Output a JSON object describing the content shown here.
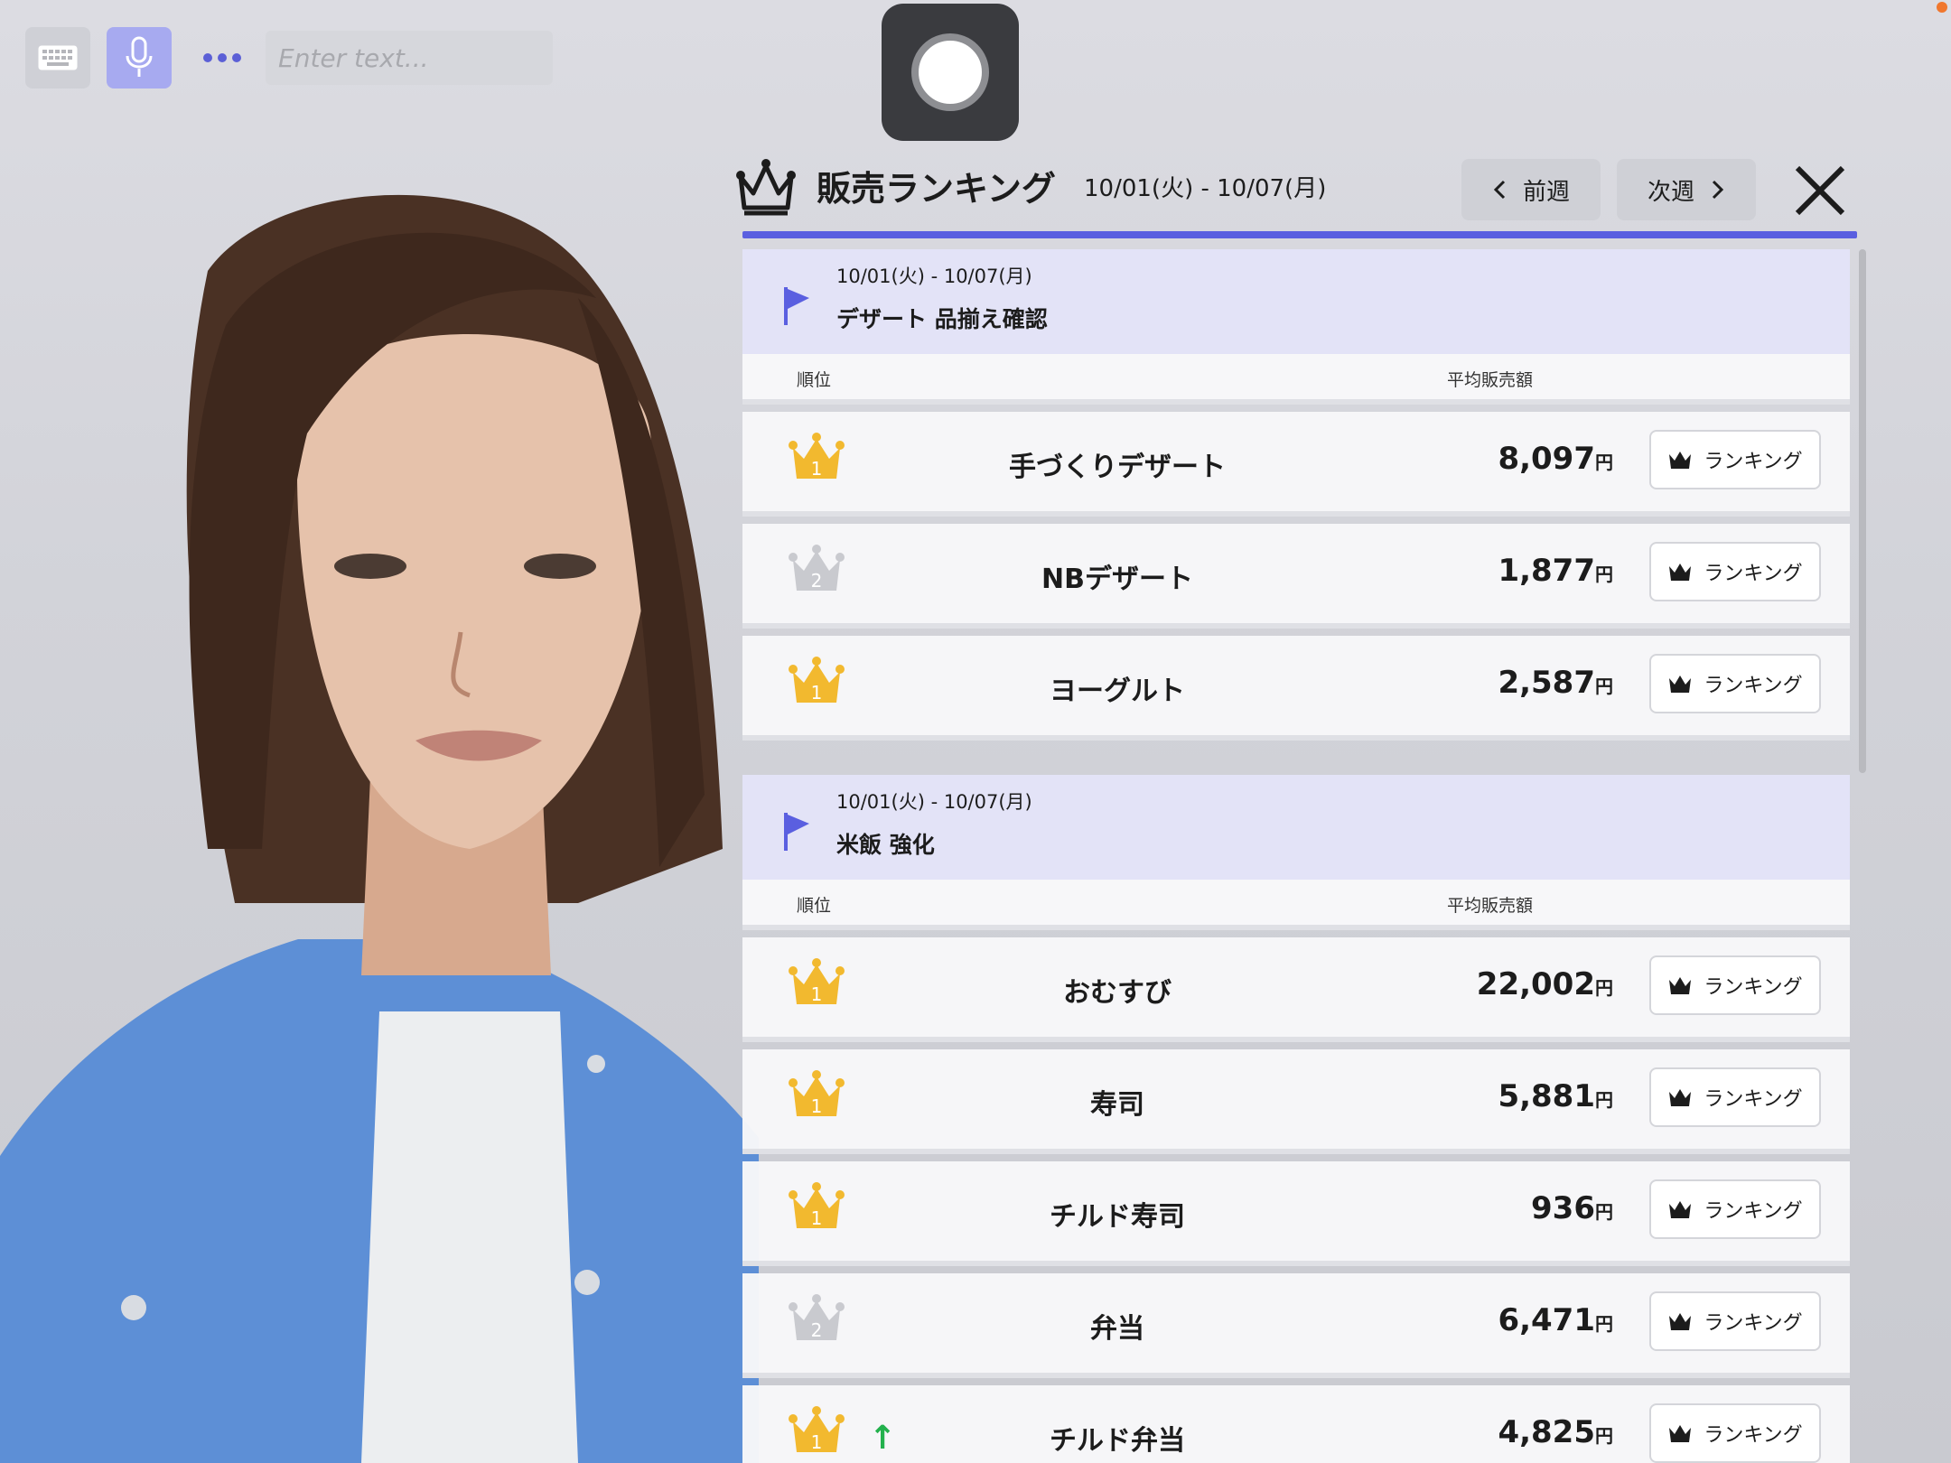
{
  "toolbar": {
    "keyboard_icon": "keyboard-icon",
    "mic_icon": "microphone-icon",
    "more_icon": "more-dots-icon",
    "input_placeholder": "Enter text...",
    "input_value": "",
    "record_icon": "record-icon"
  },
  "panel": {
    "title": "販売ランキング",
    "date_range": "10/01(火) - 10/07(月)",
    "prev_label": "前週",
    "next_label": "次週",
    "close_icon": "close-icon",
    "accent_color": "#5a5fe0",
    "gold_color": "#f2b92f",
    "silver_color": "#c9cacf"
  },
  "groups": [
    {
      "date": "10/01(火) - 10/07(月)",
      "name": "デザート 品揃え確認",
      "col_rank": "順位",
      "col_avg": "平均販売額",
      "rows": [
        {
          "rank": "1",
          "name": "手づくりデザート",
          "amount": "8,097",
          "unit": "円",
          "button": "ランキング",
          "trend": ""
        },
        {
          "rank": "2",
          "name": "NBデザート",
          "amount": "1,877",
          "unit": "円",
          "button": "ランキング",
          "trend": ""
        },
        {
          "rank": "1",
          "name": "ヨーグルト",
          "amount": "2,587",
          "unit": "円",
          "button": "ランキング",
          "trend": ""
        }
      ]
    },
    {
      "date": "10/01(火) - 10/07(月)",
      "name": "米飯 強化",
      "col_rank": "順位",
      "col_avg": "平均販売額",
      "rows": [
        {
          "rank": "1",
          "name": "おむすび",
          "amount": "22,002",
          "unit": "円",
          "button": "ランキング",
          "trend": ""
        },
        {
          "rank": "1",
          "name": "寿司",
          "amount": "5,881",
          "unit": "円",
          "button": "ランキング",
          "trend": ""
        },
        {
          "rank": "1",
          "name": "チルド寿司",
          "amount": "936",
          "unit": "円",
          "button": "ランキング",
          "trend": ""
        },
        {
          "rank": "2",
          "name": "弁当",
          "amount": "6,471",
          "unit": "円",
          "button": "ランキング",
          "trend": ""
        },
        {
          "rank": "1",
          "name": "チルド弁当",
          "amount": "4,825",
          "unit": "円",
          "button": "ランキング",
          "trend": "↑"
        }
      ]
    }
  ]
}
